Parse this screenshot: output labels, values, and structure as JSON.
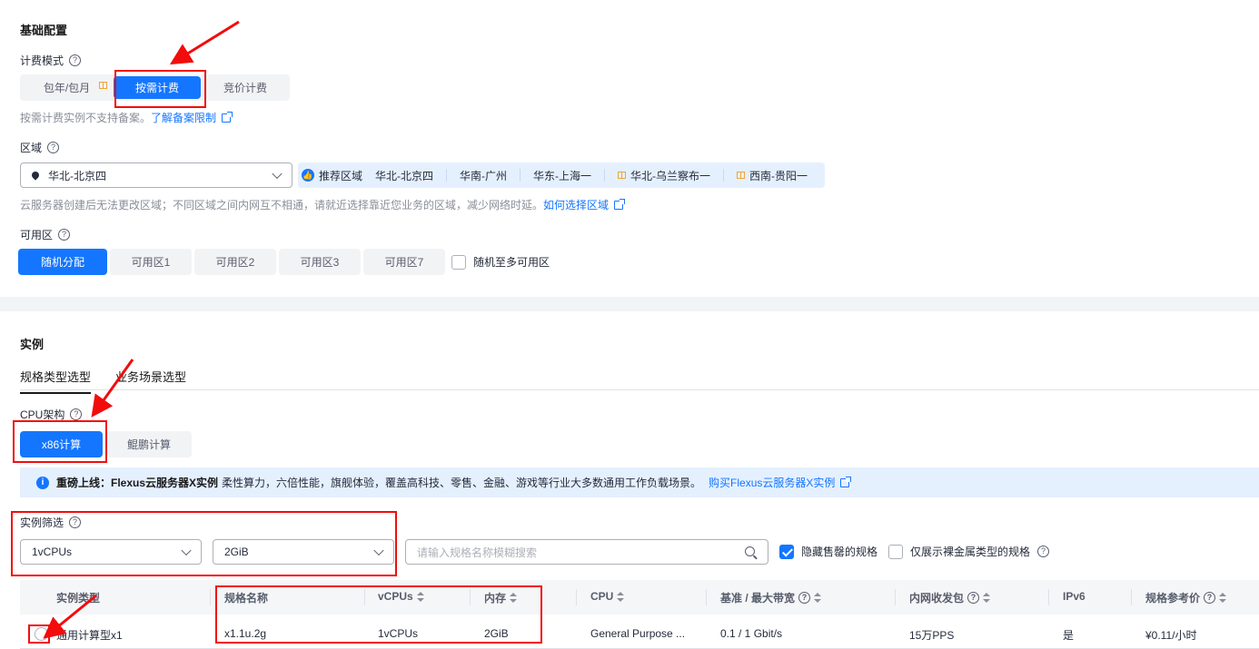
{
  "basic": {
    "title": "基础配置",
    "billing": {
      "label": "计费模式",
      "options": [
        "包年/包月",
        "按需计费",
        "竞价计费"
      ],
      "note": "按需计费实例不支持备案。",
      "note_link": "了解备案限制"
    },
    "region": {
      "label": "区域",
      "selected": "华北-北京四",
      "recommend_label": "推荐区域",
      "recommended": [
        "华北-北京四",
        "华南-广州",
        "华东-上海一",
        "华北-乌兰察布一",
        "西南-贵阳一"
      ],
      "note": "云服务器创建后无法更改区域；不同区域之间内网互不相通，请就近选择靠近您业务的区域，减少网络时延。",
      "note_link": "如何选择区域"
    },
    "az": {
      "label": "可用区",
      "options": [
        "随机分配",
        "可用区1",
        "可用区2",
        "可用区3",
        "可用区7"
      ],
      "multi_label": "随机至多可用区"
    }
  },
  "instance": {
    "title": "实例",
    "tabs": [
      "规格类型选型",
      "业务场景选型"
    ],
    "cpu": {
      "label": "CPU架构",
      "options": [
        "x86计算",
        "鲲鹏计算"
      ]
    },
    "banner": {
      "bold": "重磅上线：Flexus云服务器X实例",
      "text": "柔性算力，六倍性能，旗舰体验，覆盖高科技、零售、金融、游戏等行业大多数通用工作负载场景。",
      "link": "购买Flexus云服务器X实例"
    },
    "filter": {
      "label": "实例筛选",
      "vcpu": "1vCPUs",
      "mem": "2GiB",
      "search_placeholder": "请输入规格名称模糊搜索",
      "hide_soldout": "隐藏售罄的规格",
      "baremetal_only": "仅展示裸金属类型的规格"
    },
    "table": {
      "headers": [
        "实例类型",
        "规格名称",
        "vCPUs",
        "内存",
        "CPU",
        "基准 / 最大带宽",
        "内网收发包",
        "IPv6",
        "规格参考价"
      ],
      "row": [
        "通用计算型x1",
        "x1.1u.2g",
        "1vCPUs",
        "2GiB",
        "General Purpose ...",
        "0.1 / 1 Gbit/s",
        "15万PPS",
        "是",
        "¥0.11/小时"
      ]
    }
  },
  "colors": {
    "accent": "#1476ff",
    "annotation": "#f20c0c"
  }
}
